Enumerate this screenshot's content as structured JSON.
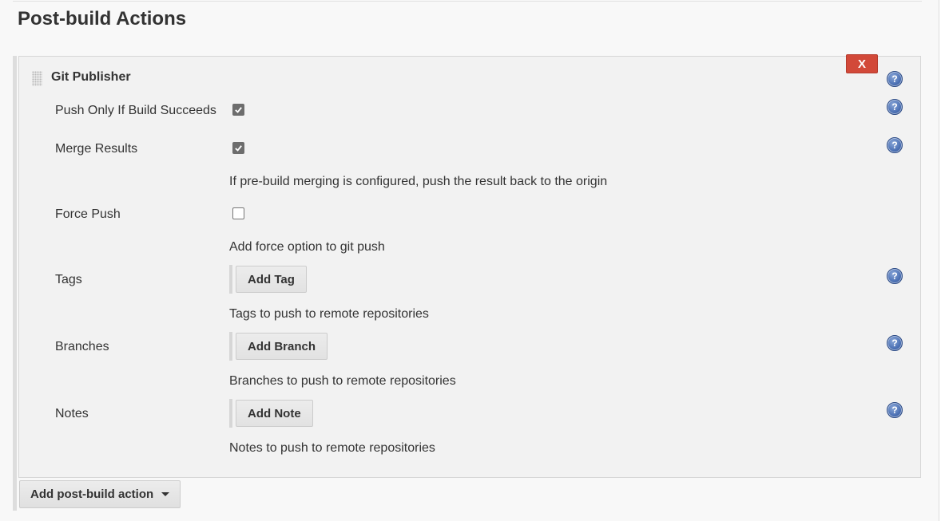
{
  "section": {
    "title": "Post-build Actions"
  },
  "publisher": {
    "title": "Git Publisher",
    "delete_label": "X",
    "help_glyph": "?",
    "push_only_if_success": {
      "label": "Push Only If Build Succeeds",
      "checked": true
    },
    "merge_results": {
      "label": "Merge Results",
      "checked": true,
      "description": "If pre-build merging is configured, push the result back to the origin"
    },
    "force_push": {
      "label": "Force Push",
      "checked": false,
      "description": "Add force option to git push"
    },
    "tags": {
      "label": "Tags",
      "button": "Add Tag",
      "description": "Tags to push to remote repositories"
    },
    "branches": {
      "label": "Branches",
      "button": "Add Branch",
      "description": "Branches to push to remote repositories"
    },
    "notes": {
      "label": "Notes",
      "button": "Add Note",
      "description": "Notes to push to remote repositories"
    }
  },
  "footer": {
    "add_action_label": "Add post-build action",
    "add_action_icon": "caret-down-icon"
  },
  "colors": {
    "delete": "#d24939",
    "help": "#4a6fb3"
  },
  "icons": {
    "help": "help-icon",
    "drag": "drag-handle-icon",
    "check": "checkmark-icon"
  }
}
